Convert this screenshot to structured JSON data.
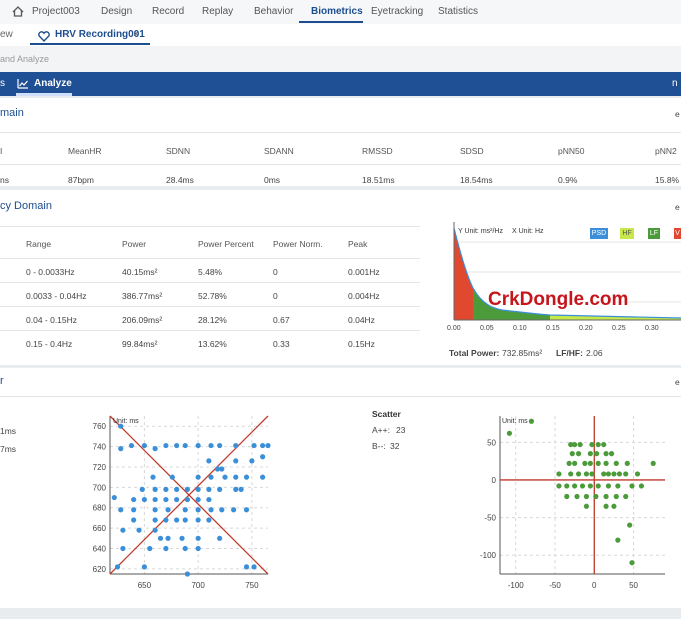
{
  "nav": {
    "project": "Project003",
    "items": [
      "Design",
      "Record",
      "Replay",
      "Behavior",
      "Biometrics",
      "Eyetracking",
      "Statistics"
    ],
    "active": "Biometrics"
  },
  "tabs": {
    "prev_tab_fragment": "ew",
    "active_tab": "HRV Recording001",
    "close_glyph": "×"
  },
  "breadcrumb": "and Analyze",
  "subtabs": {
    "left_fragment": "s",
    "active": "Analyze",
    "right_fragment": "n"
  },
  "time_domain": {
    "title": "main",
    "headers": [
      "I",
      "MeanHR",
      "SDNN",
      "SDANN",
      "RMSSD",
      "SDSD",
      "pNN50",
      "pNN2"
    ],
    "values": [
      "ns",
      "87bpm",
      "28.4ms",
      "0ms",
      "18.51ms",
      "18.54ms",
      "0.9%",
      "15.8%"
    ],
    "right_glyph": "e"
  },
  "freq_domain": {
    "title": "cy Domain",
    "headers": [
      "Range",
      "Power",
      "Power Percent",
      "Power Norm.",
      "Peak"
    ],
    "rows": [
      [
        "0 - 0.0033Hz",
        "40.15ms²",
        "5.48%",
        "0",
        "0.001Hz"
      ],
      [
        "0.0033 - 0.04Hz",
        "386.77ms²",
        "52.78%",
        "0",
        "0.004Hz"
      ],
      [
        "0.04 - 0.15Hz",
        "206.09ms²",
        "28.12%",
        "0.67",
        "0.04Hz"
      ],
      [
        "0.15 - 0.4Hz",
        "99.84ms²",
        "13.62%",
        "0.33",
        "0.15Hz"
      ]
    ],
    "total_power_label": "Total Power:",
    "total_power_value": "732.85ms²",
    "lfhf_label": "LF/HF:",
    "lfhf_value": "2.06",
    "right_glyph": "e"
  },
  "psd_chart": {
    "y_unit": "Y Unit: ms²/Hz",
    "x_unit": "X Unit: Hz",
    "legend": [
      "PSD",
      "HF",
      "LF",
      "V"
    ],
    "colors": {
      "psd": "#3b8fd9",
      "hf": "#c7e84a",
      "lf": "#4c9b3a",
      "v": "#e0492f"
    },
    "x_ticks": [
      "0.00",
      "0.05",
      "0.10",
      "0.15",
      "0.20",
      "0.25",
      "0.30"
    ]
  },
  "watermark": "CrkDongle.com",
  "poincare": {
    "title": "r",
    "left_values": [
      "1ms",
      "7ms"
    ],
    "scatter_label": "Scatter",
    "a_label": "A++:",
    "a_value": "23",
    "b_label": "B--:",
    "b_value": "32",
    "right_glyph": "e"
  },
  "chart_data": [
    {
      "type": "scatter",
      "title": "",
      "unit": "Unit: ms",
      "xlabel": "",
      "ylabel": "",
      "xlim": [
        618,
        765
      ],
      "ylim": [
        615,
        770
      ],
      "x_ticks": [
        650,
        700,
        750
      ],
      "y_ticks": [
        620,
        640,
        660,
        680,
        700,
        720,
        740,
        760
      ],
      "color": "#3b8fd9",
      "line_color": "#c0392b",
      "points": [
        [
          628,
          760
        ],
        [
          628,
          738
        ],
        [
          638,
          741
        ],
        [
          650,
          741
        ],
        [
          660,
          738
        ],
        [
          670,
          741
        ],
        [
          680,
          741
        ],
        [
          688,
          741
        ],
        [
          700,
          741
        ],
        [
          712,
          741
        ],
        [
          720,
          741
        ],
        [
          735,
          741
        ],
        [
          752,
          741
        ],
        [
          760,
          741
        ],
        [
          765,
          741
        ],
        [
          658,
          710
        ],
        [
          676,
          710
        ],
        [
          700,
          710
        ],
        [
          712,
          710
        ],
        [
          725,
          710
        ],
        [
          735,
          710
        ],
        [
          745,
          710
        ],
        [
          760,
          710
        ],
        [
          710,
          726
        ],
        [
          718,
          718
        ],
        [
          722,
          718
        ],
        [
          735,
          726
        ],
        [
          750,
          726
        ],
        [
          760,
          730
        ],
        [
          622,
          690
        ],
        [
          648,
          698
        ],
        [
          660,
          698
        ],
        [
          670,
          698
        ],
        [
          680,
          698
        ],
        [
          690,
          698
        ],
        [
          700,
          698
        ],
        [
          710,
          698
        ],
        [
          720,
          698
        ],
        [
          735,
          698
        ],
        [
          740,
          698
        ],
        [
          640,
          688
        ],
        [
          650,
          688
        ],
        [
          660,
          688
        ],
        [
          670,
          688
        ],
        [
          680,
          688
        ],
        [
          690,
          688
        ],
        [
          700,
          688
        ],
        [
          710,
          688
        ],
        [
          628,
          678
        ],
        [
          640,
          678
        ],
        [
          660,
          678
        ],
        [
          672,
          678
        ],
        [
          688,
          678
        ],
        [
          700,
          678
        ],
        [
          712,
          678
        ],
        [
          722,
          678
        ],
        [
          733,
          678
        ],
        [
          745,
          678
        ],
        [
          640,
          668
        ],
        [
          660,
          668
        ],
        [
          670,
          668
        ],
        [
          680,
          668
        ],
        [
          688,
          668
        ],
        [
          700,
          668
        ],
        [
          710,
          668
        ],
        [
          630,
          658
        ],
        [
          645,
          658
        ],
        [
          660,
          658
        ],
        [
          665,
          650
        ],
        [
          672,
          650
        ],
        [
          685,
          650
        ],
        [
          700,
          650
        ],
        [
          720,
          650
        ],
        [
          630,
          640
        ],
        [
          655,
          640
        ],
        [
          670,
          640
        ],
        [
          688,
          640
        ],
        [
          700,
          640
        ],
        [
          625,
          622
        ],
        [
          650,
          622
        ],
        [
          690,
          615
        ],
        [
          745,
          622
        ],
        [
          752,
          622
        ]
      ]
    },
    {
      "type": "scatter",
      "title": "",
      "unit": "Unit: ms",
      "xlabel": "",
      "ylabel": "",
      "xlim": [
        -120,
        90
      ],
      "ylim": [
        -125,
        85
      ],
      "x_ticks": [
        -100,
        -50,
        0,
        50
      ],
      "y_ticks": [
        50,
        0,
        -50,
        -100
      ],
      "color": "#4c9b3a",
      "line_color": "#c0392b",
      "points": [
        [
          -108,
          62
        ],
        [
          -80,
          78
        ],
        [
          -30,
          47
        ],
        [
          -25,
          47
        ],
        [
          -18,
          47
        ],
        [
          -3,
          47
        ],
        [
          5,
          47
        ],
        [
          12,
          47
        ],
        [
          -28,
          35
        ],
        [
          -20,
          35
        ],
        [
          -5,
          35
        ],
        [
          3,
          35
        ],
        [
          15,
          35
        ],
        [
          22,
          35
        ],
        [
          -32,
          22
        ],
        [
          -25,
          22
        ],
        [
          -12,
          22
        ],
        [
          -5,
          22
        ],
        [
          5,
          22
        ],
        [
          15,
          22
        ],
        [
          28,
          22
        ],
        [
          42,
          22
        ],
        [
          75,
          22
        ],
        [
          -45,
          8
        ],
        [
          -30,
          8
        ],
        [
          -20,
          8
        ],
        [
          -10,
          8
        ],
        [
          -3,
          8
        ],
        [
          12,
          8
        ],
        [
          18,
          8
        ],
        [
          25,
          8
        ],
        [
          32,
          8
        ],
        [
          40,
          8
        ],
        [
          55,
          8
        ],
        [
          -45,
          -8
        ],
        [
          -35,
          -8
        ],
        [
          -25,
          -8
        ],
        [
          -15,
          -8
        ],
        [
          -5,
          -8
        ],
        [
          5,
          -8
        ],
        [
          18,
          -8
        ],
        [
          30,
          -8
        ],
        [
          48,
          -8
        ],
        [
          60,
          -8
        ],
        [
          -35,
          -22
        ],
        [
          -22,
          -22
        ],
        [
          -10,
          -22
        ],
        [
          2,
          -22
        ],
        [
          15,
          -22
        ],
        [
          28,
          -22
        ],
        [
          40,
          -22
        ],
        [
          -10,
          -35
        ],
        [
          15,
          -35
        ],
        [
          25,
          -35
        ],
        [
          45,
          -60
        ],
        [
          30,
          -80
        ],
        [
          48,
          -110
        ]
      ]
    }
  ]
}
